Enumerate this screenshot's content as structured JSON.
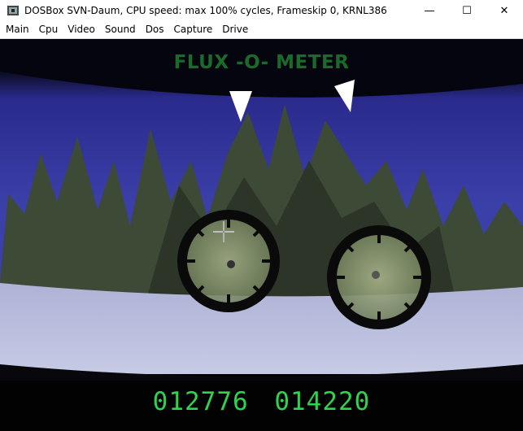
{
  "window": {
    "title": "DOSBox SVN-Daum, CPU speed: max 100% cycles, Frameskip  0,  KRNL386",
    "controls": {
      "minimize": "—",
      "maximize": "☐",
      "close": "✕"
    }
  },
  "menu": {
    "items": [
      "Main",
      "Cpu",
      "Video",
      "Sound",
      "Dos",
      "Capture",
      "Drive"
    ]
  },
  "game": {
    "title": "FLUX -O- METER",
    "counter_left": "012776",
    "counter_right": "014220",
    "colors": {
      "sky": "#2a2a8c",
      "trees": "#3b4a33",
      "snow": "#c9cfe6",
      "digits": "#2fd34d"
    }
  }
}
